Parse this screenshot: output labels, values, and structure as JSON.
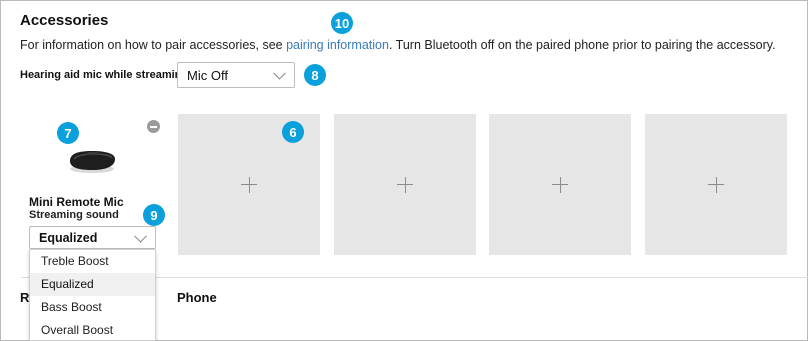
{
  "accessories": {
    "title": "Accessories",
    "info_before_link": "For information on how to pair accessories, see ",
    "info_link": "pairing information",
    "info_after_link": ". Turn Bluetooth off on the paired phone prior to pairing the accessory.",
    "mic_label": "Hearing aid mic while streaming",
    "mic_value": "Mic Off"
  },
  "device": {
    "name": "Mini Remote Mic",
    "subtitle": "Streaming sound",
    "selected_sound": "Equalized",
    "options": [
      "Treble Boost",
      "Equalized",
      "Bass Boost",
      "Overall Boost"
    ]
  },
  "sections": {
    "left_label": "R",
    "phone_label": "Phone"
  },
  "callouts": {
    "c6": "6",
    "c7": "7",
    "c8": "8",
    "c9": "9",
    "c10": "10"
  },
  "colors": {
    "callout": "#0aa0dc",
    "link": "#3a7bb8",
    "empty_slot": "#e6e6e6"
  },
  "icons": {
    "add_slot": "plus-icon",
    "remove": "minus-circle-icon",
    "select_arrow": "chevron-down-icon",
    "device": "mini-remote-mic-image"
  }
}
